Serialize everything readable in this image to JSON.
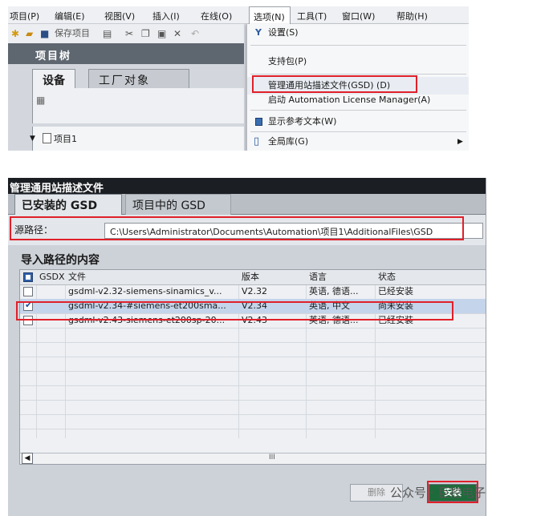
{
  "menubar": [
    "项目(P)",
    "编辑(E)",
    "视图(V)",
    "插入(I)",
    "在线(O)",
    "选项(N)",
    "工具(T)",
    "窗口(W)",
    "帮助(H)"
  ],
  "toolbar": {
    "save_label": "保存项目"
  },
  "tree": {
    "title": "项目树",
    "tab_devices": "设备",
    "tab_plant": "工厂对象",
    "root_item": "项目1"
  },
  "options_menu": [
    "设置(S)",
    "支持包(P)",
    "管理通用站描述文件(GSD) (D)",
    "启动 Automation License Manager(A)",
    "显示参考文本(W)",
    "全局库(G)"
  ],
  "dialog": {
    "title": "管理通用站描述文件",
    "tab_installed": "已安装的 GSD",
    "tab_project": "项目中的 GSD",
    "source_label": "源路径：",
    "source_path": "C:\\Users\\Administrator\\Documents\\Automation\\项目1\\AdditionalFiles\\GSD",
    "import_title": "导入路径的内容",
    "columns": [
      "GSDX",
      "文件",
      "版本",
      "语言",
      "状态"
    ],
    "rows": [
      {
        "file": "gsdml-v2.32-siemens-sinamics_v...",
        "version": "V2.32",
        "lang": "英语, 德语...",
        "status": "已经安装",
        "checked": false
      },
      {
        "file": "gsdml-v2.34-#siemens-et200sma...",
        "version": "V2.34",
        "lang": "英语, 中文",
        "status": "尚未安装",
        "checked": true
      },
      {
        "file": "gsdml-v2.43-siemens-et200sp-20...",
        "version": "V2.43",
        "lang": "英语, 德语...",
        "status": "已经安装",
        "checked": false
      }
    ],
    "scroll_mid": "III",
    "delete_label": "删除",
    "install_label": "安装"
  },
  "watermark": "公众号 · 巨控电子",
  "colors": {
    "highlight": "#e0202a",
    "title_bar": "#1b1e22",
    "selected_row": "#c4d4ea"
  }
}
